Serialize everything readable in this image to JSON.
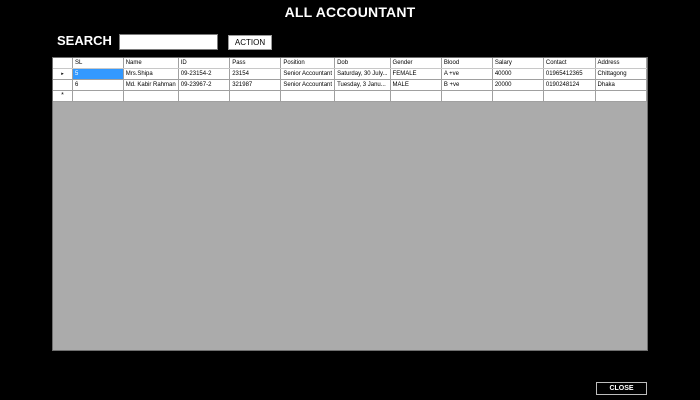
{
  "title": "ALL ACCOUNTANT",
  "search": {
    "label": "SEARCH",
    "value": "",
    "button": "ACTION"
  },
  "table": {
    "columns": [
      "SL",
      "Name",
      "ID",
      "Pass",
      "Position",
      "Dob",
      "Gender",
      "Blood",
      "Salary",
      "Contact",
      "Address"
    ],
    "rows": [
      [
        "5",
        "Mrs.Shipa",
        "09-23154-2",
        "23154",
        "Senior Accountant",
        "Saturday, 30 July...",
        "FEMALE",
        "A +ve",
        "40000",
        "01965412365",
        "Chittagong"
      ],
      [
        "6",
        "Md. Kabir Rahman",
        "09-23967-2",
        "321987",
        "Senior Accountant",
        "Tuesday, 3 Janu...",
        "MALE",
        "B +ve",
        "20000",
        "0190248124",
        "Dhaka"
      ]
    ],
    "current_row_marker": "▸",
    "new_row_marker": "*"
  },
  "close_button": "CLOSE",
  "colors": {
    "background": "#000000",
    "grid_empty": "#ababab",
    "selection": "#3399ff"
  }
}
